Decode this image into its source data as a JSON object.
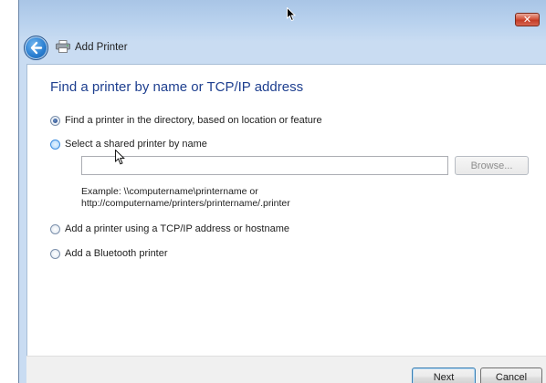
{
  "window": {
    "close_glyph": "✕",
    "title": "Add Printer",
    "icons": {
      "back": "back-arrow-icon",
      "printer": "printer-icon",
      "close": "close-icon"
    }
  },
  "page": {
    "heading": "Find a printer by name or TCP/IP address",
    "options": [
      {
        "label": "Find a printer in the directory, based on location or feature",
        "checked": true
      },
      {
        "label": "Select a shared printer by name",
        "checked": false
      },
      {
        "label": "Add a printer using a TCP/IP address or hostname",
        "checked": false
      },
      {
        "label": "Add a Bluetooth printer",
        "checked": false
      }
    ],
    "shared_printer_input": {
      "value": "",
      "placeholder": ""
    },
    "browse_label": "Browse...",
    "example_line1": "Example: \\\\computername\\printername or",
    "example_line2": "http://computername/printers/printername/.printer"
  },
  "footer": {
    "next_label": "Next",
    "cancel_label": "Cancel"
  },
  "colors": {
    "heading": "#1e3f8f",
    "frame": "#c9dcf2",
    "close": "#c43c26"
  }
}
